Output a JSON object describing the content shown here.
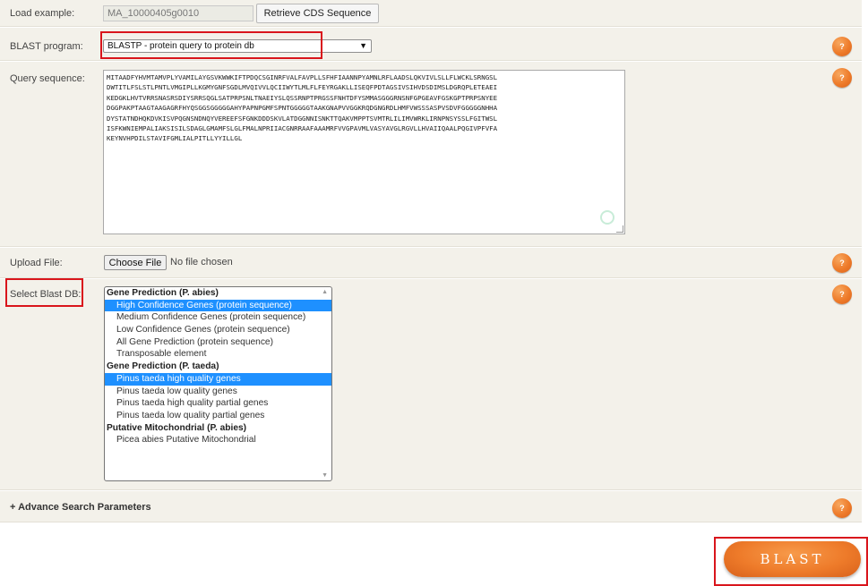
{
  "load_example": {
    "label": "Load example:",
    "value": "MA_10000405g0010",
    "retrieve_button": "Retrieve CDS Sequence"
  },
  "blast_program": {
    "label": "BLAST program:",
    "selected": "BLASTP - protein query to protein db"
  },
  "query_sequence": {
    "label": "Query sequence:",
    "lines": [
      "MITAADFYHVMTAMVPLYVAMILAYGSVKWWKIFTPDQCSGINRFVALFAVPLLSFHFIAANNPYAMNLRFLAADSLQKVIVLSLLFLWCKLSRNGSL",
      "DWTITLFSLSTLPNTLVMGIPLLKGMYGNFSGDLMVQIVVLQCIIWYTLMLFLFEYRGAKLLISEQFPDTAGSIVSIHVDSDIMSLDGRQPLETEAEI",
      "KEDGKLHVTVRRSNASRSDIYSRRSQGLSATPRPSNLTNAEIYSLQSSRNPTPRGSSFNHTDFYSMMASGGGRNSNFGPGEAVFGSKGPTPRPSNYEE",
      "DGGPAKPTAAGTAAGAGRFHYQSGGSGGGGGAHYPAPNPGMFSPNTGGGGGTAAKGNAPVVGGKRQDGNGRDLHMFVWSSSASPVSDVFGGGGGNHHA",
      "DYSTATNDHQKDVKISVPQGNSNDNQYVEREEFSFGNKDDDSKVLATDGGNNISNKTTQAKVMPPTSVMTRLILIMVWRKLIRNPNSYSSLFGITWSL",
      "ISFKWNIEMPALIAKSISILSDAGLGMAMFSLGLFMALNPRIIACGNRRAAFAAAMRFVVGPAVMLVASYAVGLRGVLLHVAIIQAALPQGIVPFVFA",
      "KEYNVHPDILSTAVIFGMLIALPITLLYYILLGL"
    ]
  },
  "upload_file": {
    "label": "Upload File:",
    "button": "Choose File",
    "status": "No file chosen"
  },
  "blast_db": {
    "label": "Select Blast DB:",
    "options": [
      {
        "text": "Gene Prediction (P. abies)",
        "group": true,
        "selected": false
      },
      {
        "text": "High Confidence Genes (protein sequence)",
        "group": false,
        "selected": true
      },
      {
        "text": "Medium Confidence Genes (protein sequence)",
        "group": false,
        "selected": false
      },
      {
        "text": "Low Confidence Genes (protein sequence)",
        "group": false,
        "selected": false
      },
      {
        "text": "All Gene Prediction (protein sequence)",
        "group": false,
        "selected": false
      },
      {
        "text": "Transposable element",
        "group": false,
        "selected": false
      },
      {
        "text": "Gene Prediction (P. taeda)",
        "group": true,
        "selected": false
      },
      {
        "text": "Pinus taeda high quality genes",
        "group": false,
        "selected": true
      },
      {
        "text": "Pinus taeda low quality genes",
        "group": false,
        "selected": false
      },
      {
        "text": "Pinus taeda high quality partial genes",
        "group": false,
        "selected": false
      },
      {
        "text": "Pinus taeda low quality partial genes",
        "group": false,
        "selected": false
      },
      {
        "text": "Putative Mitochondrial (P. abies)",
        "group": true,
        "selected": false
      },
      {
        "text": "Picea abies Putative Mitochondrial",
        "group": false,
        "selected": false
      }
    ]
  },
  "advance": {
    "label": "+ Advance Search Parameters"
  },
  "help_label": "?",
  "blast_button": "BLAST",
  "colors": {
    "accent_orange": "#ee7b2a",
    "highlight_red": "#d9151c",
    "selection_blue": "#1e90ff",
    "row_background": "#f3f1ea"
  }
}
